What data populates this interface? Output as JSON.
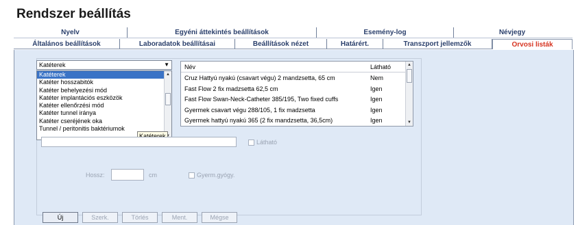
{
  "page_title": "Rendszer beállítás",
  "tabs_row1": [
    "Nyelv",
    "Egyéni áttekintés beállítások",
    "Esemény-log",
    "Névjegy"
  ],
  "tabs_row2": [
    "Általános beállítások",
    "Laboradatok beállításai",
    "Beállítások nézet",
    "Határért.",
    "Transzport jellemzők",
    "Orvosi listák"
  ],
  "active_tab": "Orvosi listák",
  "category_combo": {
    "value": "Katéterek",
    "options": [
      "Katéterek",
      "Katéter hosszabitók",
      "Katéter behelyezési mód",
      "Katéter implantációs eszközök",
      "Katéter ellenőrzési mód",
      "Katéter tunnel iránya",
      "Katéter cseréjének oka",
      "Tunnel / peritonitis baktériumok"
    ],
    "selected_index": 0
  },
  "tooltip": "Katéterek",
  "table": {
    "columns": [
      "Név",
      "Látható"
    ],
    "rows": [
      {
        "name": "Cruz Hattyú nyakú (csavart végu) 2 mandzsetta, 65 cm",
        "visible": "Nem"
      },
      {
        "name": "Fast Flow 2 fix madzsetta 62,5 cm",
        "visible": "Igen"
      },
      {
        "name": "Fast Flow Swan-Neck-Catheter 385/195, Two fixed cuffs",
        "visible": "Igen"
      },
      {
        "name": "Gyermek csavart végu 288/105, 1 fix madzsetta",
        "visible": "Igen"
      },
      {
        "name": "Gyermek hattyú nyakú 365 (2 fix mandzsetta, 36,5cm)",
        "visible": "Igen"
      }
    ]
  },
  "form": {
    "visible_label": "Látható",
    "length_label": "Hossz:",
    "length_unit": "cm",
    "pediatric_label": "Gyerm.gyógy."
  },
  "buttons": {
    "new": "Új",
    "edit": "Szerk.",
    "delete": "Törlés",
    "save": "Ment.",
    "cancel": "Mégse"
  },
  "colors": {
    "active_tab": "#d6331f",
    "tab_text": "#2a3f6b",
    "panel_bg": "#dfe9f6",
    "selection": "#3a73c6"
  }
}
